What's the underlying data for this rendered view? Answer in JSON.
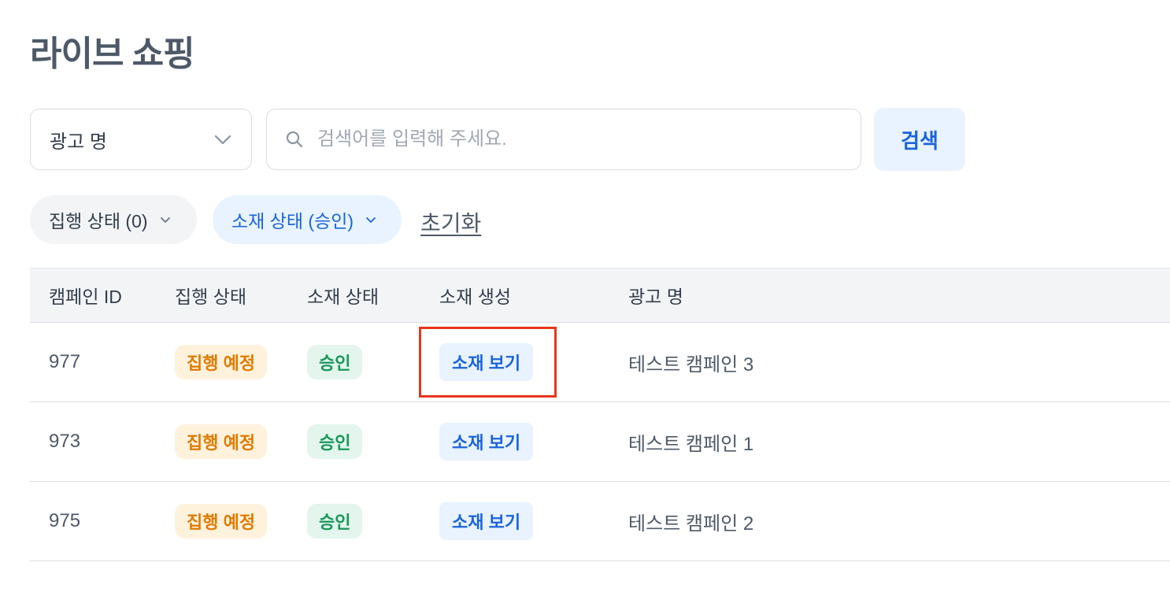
{
  "page": {
    "title": "라이브 쇼핑"
  },
  "search": {
    "field_select": "광고 명",
    "placeholder": "검색어를 입력해 주세요.",
    "button_label": "검색"
  },
  "filters": {
    "chips": [
      {
        "label": "집행 상태 (0)"
      },
      {
        "label": "소재 상태 (승인)"
      }
    ],
    "reset_label": "초기화"
  },
  "table": {
    "columns": [
      "캠페인 ID",
      "집행 상태",
      "소재 상태",
      "소재 생성",
      "광고 명"
    ],
    "rows": [
      {
        "id": "977",
        "exec_status": "집행 예정",
        "material_status": "승인",
        "action": "소재 보기",
        "name": "테스트 캠페인 3"
      },
      {
        "id": "973",
        "exec_status": "집행 예정",
        "material_status": "승인",
        "action": "소재 보기",
        "name": "테스트 캠페인 1"
      },
      {
        "id": "975",
        "exec_status": "집행 예정",
        "material_status": "승인",
        "action": "소재 보기",
        "name": "테스트 캠페인 2"
      }
    ]
  },
  "colors": {
    "accent_blue": "#1b64da",
    "highlight_red": "#e8351b",
    "status_orange": "#e07b00",
    "status_green": "#18985a"
  },
  "icons": [
    "chevron-down-icon",
    "search-icon"
  ]
}
